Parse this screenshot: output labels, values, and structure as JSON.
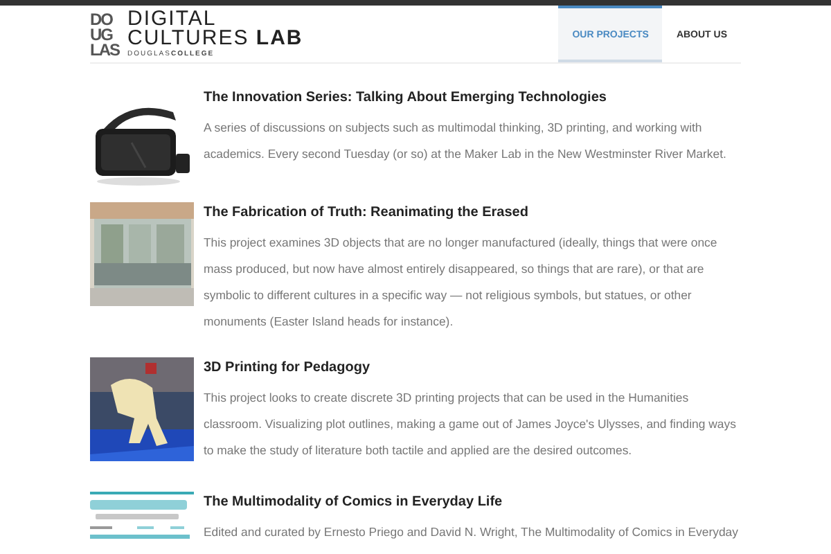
{
  "header": {
    "logo_mark": [
      "DO",
      "UG",
      "LAS"
    ],
    "logo_title": [
      "DIGITAL",
      "CULTURES **LAB**"
    ],
    "logo_subtitle": "DOUGLAS**COLLEGE**",
    "nav": [
      {
        "label": "OUR PROJECTS",
        "selected": true
      },
      {
        "label": "ABOUT US",
        "selected": false
      }
    ]
  },
  "projects": [
    {
      "title": "The Innovation Series: Talking About Emerging Technologies",
      "description": "A series of discussions on subjects such as multimodal thinking, 3D printing, and working with academics. Every second Tuesday (or so) at the Maker Lab in the New Westminster River Market."
    },
    {
      "title": "The Fabrication of Truth: Reanimating the Erased",
      "description": "This project examines 3D objects that are no longer manufactured (ideally, things that were once mass produced, but now have almost entirely disappeared, so things that are rare), or that are symbolic to different cultures in a specific way — not religious symbols, but statues, or other monuments (Easter Island heads for instance)."
    },
    {
      "title": "3D Printing for Pedagogy",
      "description": "This project looks to create discrete 3D printing projects that can be used in the Humanities classroom. Visualizing plot outlines, making a game out of James Joyce's Ulysses, and finding ways to make the study of literature both tactile and applied are the desired outcomes."
    },
    {
      "title": "The Multimodality of Comics in Everyday Life",
      "description": "Edited and curated by Ernesto Priego and David N. Wright, The Multimodality of Comics in Everyday"
    }
  ]
}
